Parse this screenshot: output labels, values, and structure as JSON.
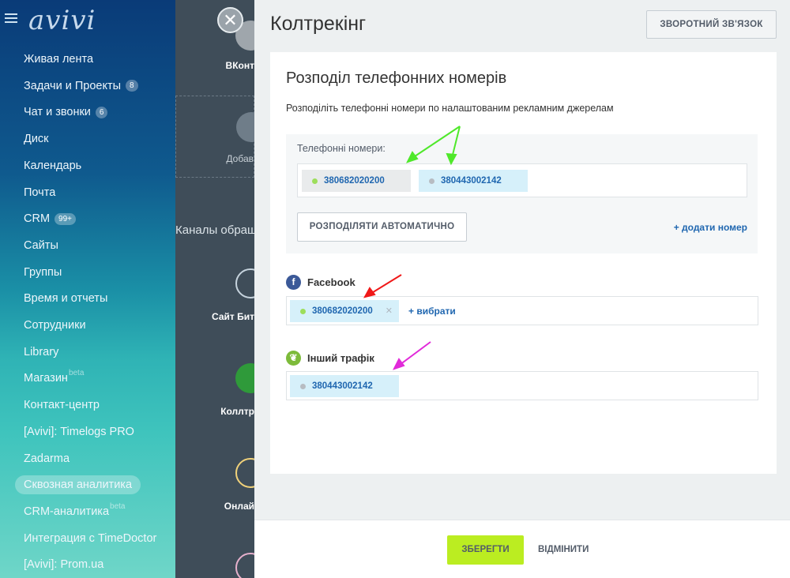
{
  "app": {
    "logo": "avivi"
  },
  "sidebar": {
    "items": [
      {
        "label": "Живая лента",
        "badge": ""
      },
      {
        "label": "Задачи и Проекты",
        "badge": "8"
      },
      {
        "label": "Чат и звонки",
        "badge": "6"
      },
      {
        "label": "Диск",
        "badge": ""
      },
      {
        "label": "Календарь",
        "badge": ""
      },
      {
        "label": "Почта",
        "badge": ""
      },
      {
        "label": "CRM",
        "badge": "99+"
      },
      {
        "label": "Сайты",
        "badge": ""
      },
      {
        "label": "Группы",
        "badge": ""
      },
      {
        "label": "Время и отчеты",
        "badge": ""
      },
      {
        "label": "Сотрудники",
        "badge": ""
      },
      {
        "label": "Library",
        "badge": ""
      },
      {
        "label": "Магазин",
        "badge": "",
        "sup": "beta"
      },
      {
        "label": "Контакт-центр",
        "badge": ""
      },
      {
        "label": "[Avivi]: Timelogs PRO",
        "badge": ""
      },
      {
        "label": "Zadarma",
        "badge": ""
      },
      {
        "label": "Сквозная аналитика",
        "badge": "",
        "active": true
      },
      {
        "label": "CRM-аналитика",
        "badge": "",
        "sup": "beta"
      },
      {
        "label": "Интеграция с TimeDoctor",
        "badge": ""
      },
      {
        "label": "[Avivi]: Prom.ua",
        "badge": ""
      }
    ]
  },
  "background": {
    "tiles": [
      {
        "label": "ВКонт",
        "color": "#a9aeb3"
      },
      {
        "label": "Добав",
        "color": "#4a5662"
      },
      {
        "label": "Сайт Бит",
        "color": "#5e7a90"
      },
      {
        "label": "Коллтр",
        "color": "#9ea6ad"
      },
      {
        "label": "Онлай",
        "color": "#d5a514"
      },
      {
        "label": "",
        "color": "#b4578a"
      }
    ],
    "channels_heading": "Каналы обращ"
  },
  "panel": {
    "title": "Колтрекінг",
    "feedback_button": "ЗВОРОТНИЙ ЗВ'ЯЗОК",
    "card": {
      "title": "Розподіл телефонних номерів",
      "description": "Розподіліть телефонні номери по налаштованим рекламним джерелам",
      "phones_label": "Телефонні номери:",
      "phones": [
        {
          "number": "380682020200",
          "dot_color": "#9dde5b",
          "bg": "#e9ebec"
        },
        {
          "number": "380443002142",
          "dot_color": "#b7bcc2",
          "bg": "#d6f0fa"
        }
      ],
      "auto_button": "РОЗПОДІЛЯТИ АВТОМАТИЧНО",
      "add_number": "+ додати номер",
      "sources": [
        {
          "name": "Facebook",
          "icon": "facebook-icon",
          "icon_color": "#3b5998",
          "number": "380682020200",
          "dot_color": "#9dde5b",
          "choose": "+ вибрати"
        },
        {
          "name": "Інший трафік",
          "icon": "leaf-icon",
          "icon_color": "#7dbb3a",
          "number": "380443002142",
          "dot_color": "#b7bcc2",
          "choose": ""
        }
      ]
    },
    "footer": {
      "save": "ЗБЕРЕГТИ",
      "cancel": "ВІДМІНИТИ"
    }
  },
  "colors": {
    "accent_link": "#2067b0",
    "save_button": "#bbed21",
    "arrow_green": "#4fe82a",
    "arrow_red": "#f01818",
    "arrow_magenta": "#e12ad9"
  }
}
